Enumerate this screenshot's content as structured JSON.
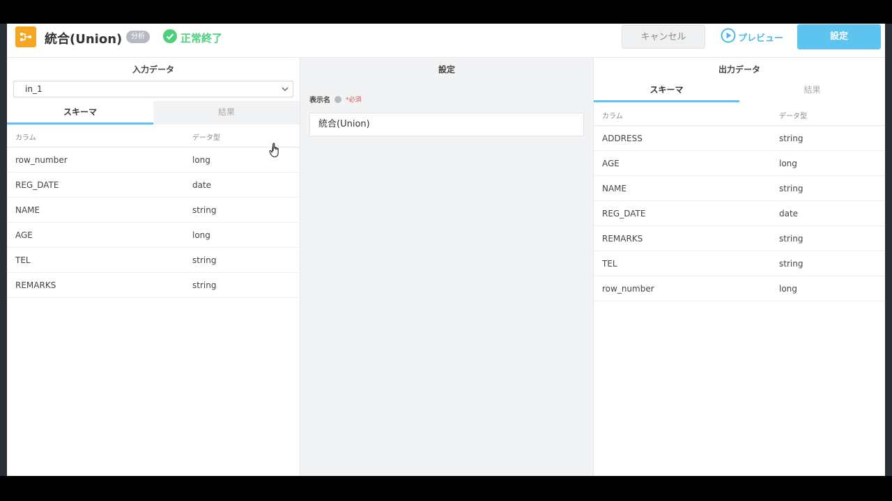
{
  "header": {
    "title": "統合(Union)",
    "kind_badge": "分析",
    "status": "正常終了",
    "cancel_label": "キャンセル",
    "preview_label": "プレビュー",
    "ok_label": "設定",
    "icons": {
      "app": "union-node-icon",
      "status": "check-circle-icon",
      "preview": "play-circle-icon"
    },
    "colors": {
      "app_icon": "#f5a623",
      "status": "#4cd07a",
      "primary": "#5dc4f0"
    }
  },
  "input": {
    "title": "入力データ",
    "selected_input": "in_1",
    "tabs": [
      {
        "label": "スキーマ"
      },
      {
        "label": "結果"
      }
    ],
    "columns": {
      "name": "カラム",
      "type": "データ型"
    },
    "rows": [
      {
        "name": "row_number",
        "type": "long"
      },
      {
        "name": "REG_DATE",
        "type": "date"
      },
      {
        "name": "NAME",
        "type": "string"
      },
      {
        "name": "AGE",
        "type": "long"
      },
      {
        "name": "TEL",
        "type": "string"
      },
      {
        "name": "REMARKS",
        "type": "string"
      }
    ]
  },
  "settings": {
    "title": "設定",
    "display_name_label": "表示名",
    "required_label": "*必須",
    "display_name_value": "統合(Union)"
  },
  "output": {
    "title": "出力データ",
    "tabs": [
      {
        "label": "スキーマ"
      },
      {
        "label": "結果"
      }
    ],
    "columns": {
      "name": "カラム",
      "type": "データ型"
    },
    "rows": [
      {
        "name": "ADDRESS",
        "type": "string"
      },
      {
        "name": "AGE",
        "type": "long"
      },
      {
        "name": "NAME",
        "type": "string"
      },
      {
        "name": "REG_DATE",
        "type": "date"
      },
      {
        "name": "REMARKS",
        "type": "string"
      },
      {
        "name": "TEL",
        "type": "string"
      },
      {
        "name": "row_number",
        "type": "long"
      }
    ]
  }
}
